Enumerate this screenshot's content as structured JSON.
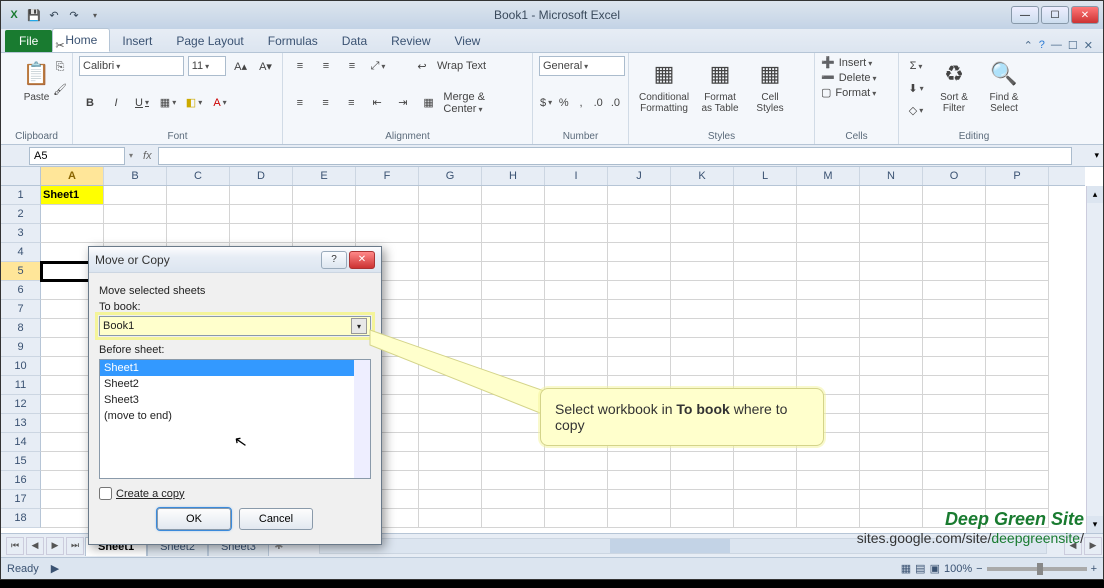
{
  "titlebar": {
    "title": "Book1 - Microsoft Excel"
  },
  "tabs": {
    "file": "File",
    "items": [
      "Home",
      "Insert",
      "Page Layout",
      "Formulas",
      "Data",
      "Review",
      "View"
    ],
    "active": "Home"
  },
  "ribbon": {
    "clipboard": {
      "label": "Clipboard",
      "paste": "Paste"
    },
    "font": {
      "label": "Font",
      "family": "Calibri",
      "size": "11",
      "bold": "B",
      "italic": "I",
      "underline": "U"
    },
    "alignment": {
      "label": "Alignment",
      "wrap": "Wrap Text",
      "merge": "Merge & Center"
    },
    "number": {
      "label": "Number",
      "format": "General"
    },
    "styles": {
      "label": "Styles",
      "cond": "Conditional\nFormatting",
      "table": "Format\nas Table",
      "cell": "Cell\nStyles"
    },
    "cells": {
      "label": "Cells",
      "insert": "Insert",
      "delete": "Delete",
      "format": "Format"
    },
    "editing": {
      "label": "Editing",
      "sort": "Sort &\nFilter",
      "find": "Find &\nSelect"
    }
  },
  "formulabar": {
    "name": "A5",
    "fx": "fx"
  },
  "columns": [
    "A",
    "B",
    "C",
    "D",
    "E",
    "F",
    "G",
    "H",
    "I",
    "J",
    "K",
    "L",
    "M",
    "N",
    "O",
    "P"
  ],
  "rows": [
    "1",
    "2",
    "3",
    "4",
    "5",
    "6",
    "7",
    "8",
    "9",
    "10",
    "11",
    "12",
    "13",
    "14",
    "15",
    "16",
    "17",
    "18"
  ],
  "cellA1": "Sheet1",
  "sheets": {
    "tabs": [
      "Sheet1",
      "Sheet2",
      "Sheet3"
    ],
    "active": "Sheet1"
  },
  "status": {
    "ready": "Ready",
    "zoom": "100%"
  },
  "dialog": {
    "title": "Move or Copy",
    "intro": "Move selected sheets",
    "toBookLabel": "To book:",
    "toBookValue": "Book1",
    "beforeLabel": "Before sheet:",
    "list": [
      "Sheet1",
      "Sheet2",
      "Sheet3",
      "(move to end)"
    ],
    "listSelected": "Sheet1",
    "createCopy": "Create a copy",
    "ok": "OK",
    "cancel": "Cancel"
  },
  "callout": {
    "line1": "Select workbook in ",
    "bold": "To book",
    "line2": " where to copy"
  },
  "watermark": {
    "brand": "Deep Green Site",
    "urlPrefix": "sites.google.com/site/",
    "urlGreen": "deepgreensite",
    "urlSuffix": "/"
  }
}
